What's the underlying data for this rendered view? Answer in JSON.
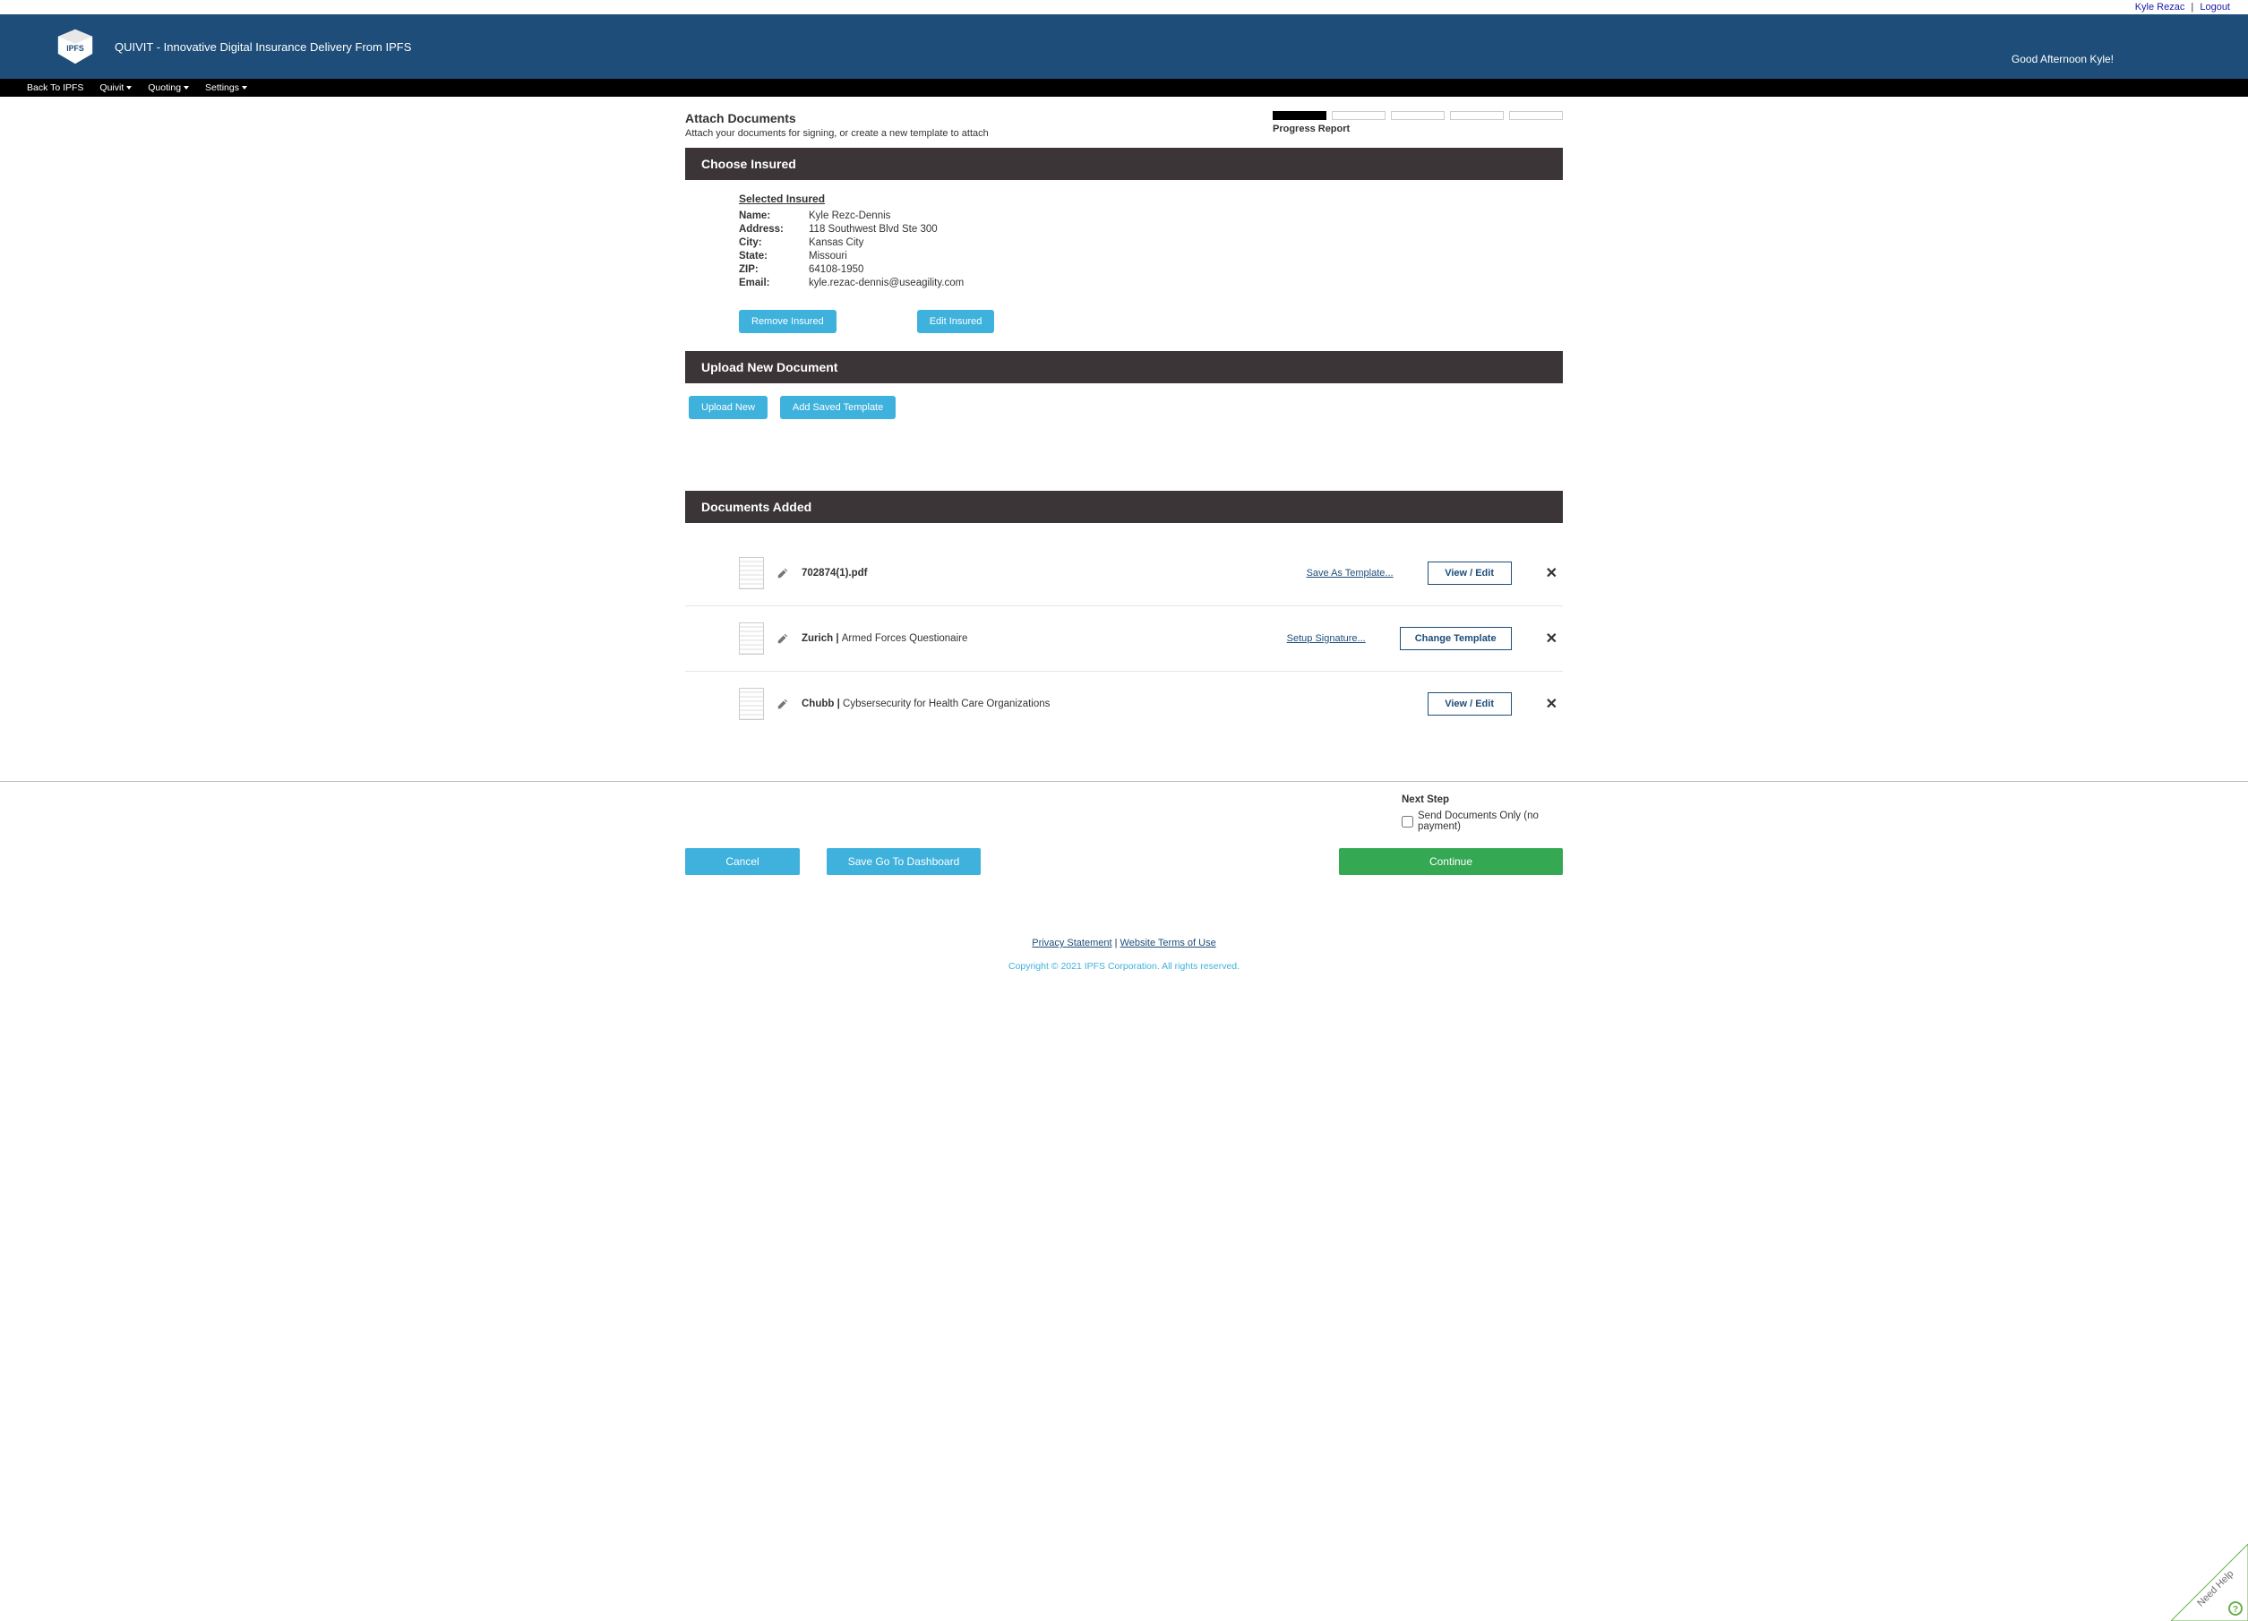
{
  "top_links": {
    "user": "Kyle Rezac",
    "logout": "Logout"
  },
  "header": {
    "title": "QUIVIT - Innovative Digital Insurance Delivery From IPFS",
    "greeting": "Good Afternoon Kyle!"
  },
  "nav": {
    "back": "Back To IPFS",
    "quivit": "Quivit",
    "quoting": "Quoting",
    "settings": "Settings"
  },
  "page": {
    "title": "Attach Documents",
    "subtitle": "Attach your documents for signing, or create a new template to attach",
    "progress_label": "Progress Report"
  },
  "sections": {
    "choose_insured": "Choose Insured",
    "upload_new": "Upload New Document",
    "docs_added": "Documents Added"
  },
  "insured": {
    "heading": "Selected Insured",
    "labels": {
      "name": "Name:",
      "address": "Address:",
      "city": "City:",
      "state": "State:",
      "zip": "ZIP:",
      "email": "Email:"
    },
    "name": "Kyle Rezc-Dennis",
    "address": "118 Southwest Blvd Ste 300",
    "city": "Kansas City",
    "state": "Missouri",
    "zip": "64108-1950",
    "email": "kyle.rezac-dennis@useagility.com",
    "remove_btn": "Remove Insured",
    "edit_btn": "Edit Insured"
  },
  "upload": {
    "upload_btn": "Upload New",
    "add_template_btn": "Add Saved Template"
  },
  "docs": [
    {
      "name_bold": "702874(1).pdf",
      "name_tail": "",
      "link_label": "Save As Template...",
      "action_btn": "View / Edit"
    },
    {
      "name_bold": "Zurich | ",
      "name_tail": "Armed Forces Questionaire",
      "link_label": "Setup Signature...",
      "action_btn": "Change Template"
    },
    {
      "name_bold": "Chubb | ",
      "name_tail": "Cybsersecurity for Health Care Organizations",
      "link_label": "",
      "action_btn": "View / Edit"
    }
  ],
  "footer": {
    "next_step": "Next Step",
    "checkbox_label": "Send Documents Only (no payment)",
    "cancel": "Cancel",
    "save_dash": "Save Go To Dashboard",
    "continue": "Continue"
  },
  "legal": {
    "privacy": "Privacy Statement",
    "terms": "Website Terms of Use",
    "copyright": "Copyright © 2021 IPFS Corporation. All rights reserved."
  },
  "need_help": "Need Help"
}
